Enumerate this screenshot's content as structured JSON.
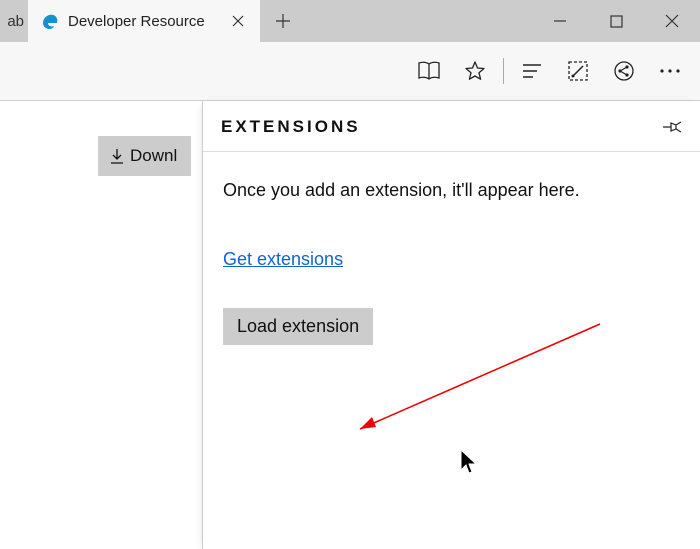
{
  "titlebar": {
    "stub_tab_label": "ab",
    "active_tab_title": "Developer Resource"
  },
  "page": {
    "download_button_label": "Downl"
  },
  "flyout": {
    "title": "EXTENSIONS",
    "body_text": "Once you add an extension, it'll appear here.",
    "get_link_label": "Get extensions",
    "load_button_label": "Load extension"
  }
}
